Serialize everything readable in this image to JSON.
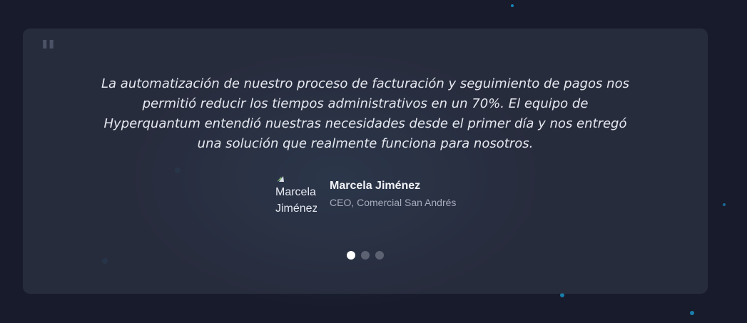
{
  "testimonial": {
    "quote_icon": "quote-mark-icon",
    "quote_mark": "\"",
    "quote": "La automatización de nuestro proceso de facturación y seguimiento de pagos nos permitió reducir los tiempos administrativos en un 70%. El equipo de Hyperquantum entendió nuestras necesidades desde el primer día y nos entregó una solución que realmente funciona para nosotros.",
    "author": {
      "avatar_alt": "Marcela Jiménez",
      "avatar_icon": "broken-image-icon",
      "name": "Marcela Jiménez",
      "role": "CEO, Comercial San Andrés"
    }
  },
  "carousel": {
    "total_slides": 3,
    "active_index": 0
  },
  "colors": {
    "background": "#181b2b",
    "card": "#2c3142",
    "accent_particles": "#1aa0d8",
    "dot_active": "#ffffff",
    "dot_inactive": "#5d6272"
  }
}
